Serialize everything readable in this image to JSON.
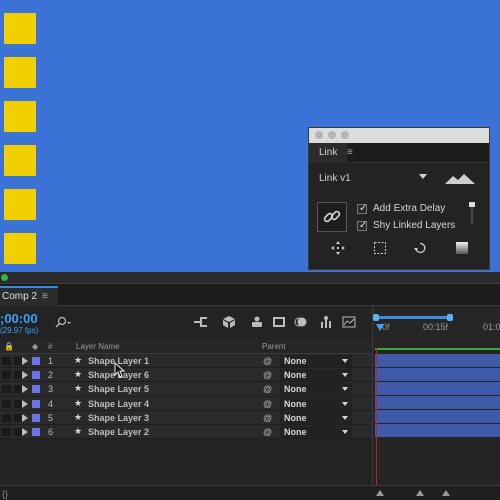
{
  "link_panel": {
    "tab_label": "Link",
    "tab_menu": "≡",
    "dropdown_value": "Link v1",
    "checkboxes": [
      {
        "label": "Add Extra Delay",
        "checked": true
      },
      {
        "label": "Shy Linked Layers",
        "checked": true
      }
    ],
    "icons": [
      "link-icon",
      "move-icon",
      "select-rect-icon",
      "loop-icon",
      "gradient-icon",
      "mountain-icon"
    ]
  },
  "timeline": {
    "tab_label": "Comp 2",
    "tab_menu": "≡",
    "timecode": ";00:00",
    "fps": "(29.97 fps)",
    "ruler_ticks": [
      "0f",
      "00:15f",
      "01:0"
    ],
    "columns": {
      "layer_name": "Layer Name",
      "parent": "Parent",
      "number": "#"
    },
    "layers": [
      {
        "num": "1",
        "name": "Shape Layer 1",
        "parent": "None"
      },
      {
        "num": "2",
        "name": "Shape Layer 6",
        "parent": "None"
      },
      {
        "num": "3",
        "name": "Shape Layer 5",
        "parent": "None"
      },
      {
        "num": "4",
        "name": "Shape Layer 4",
        "parent": "None"
      },
      {
        "num": "5",
        "name": "Shape Layer 3",
        "parent": "None"
      },
      {
        "num": "6",
        "name": "Shape Layer 2",
        "parent": "None"
      }
    ],
    "bottom_left": "{}"
  },
  "colors": {
    "canvas_bg": "#3b72d6",
    "shape_yellow": "#f2cf00",
    "accent_blue": "#3ba1ff",
    "layer_label": "#6a74e8",
    "track_bar": "#3f5aa8"
  }
}
